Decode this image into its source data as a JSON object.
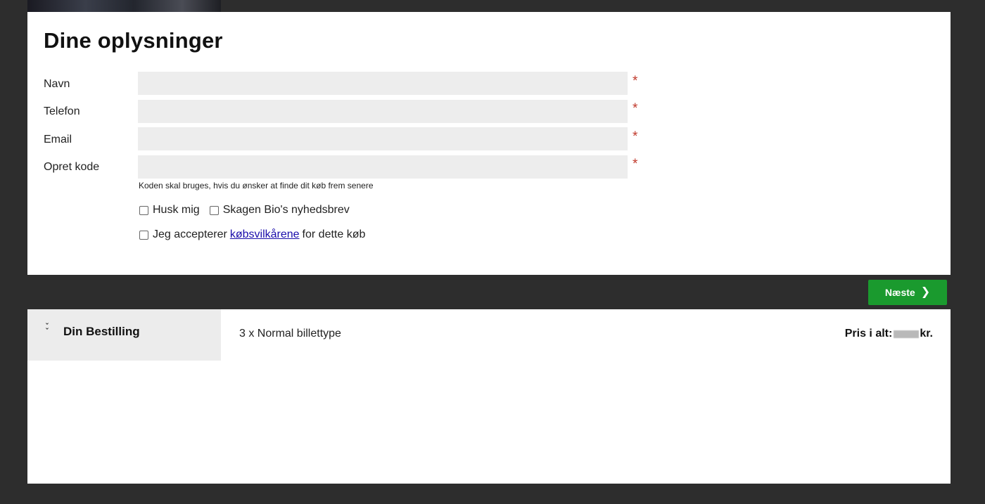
{
  "form": {
    "title": "Dine oplysninger",
    "fields": [
      {
        "label": "Navn",
        "value": "",
        "required": "*"
      },
      {
        "label": "Telefon",
        "value": "",
        "required": "*"
      },
      {
        "label": "Email",
        "value": "",
        "required": "*"
      },
      {
        "label": "Opret kode",
        "value": "",
        "required": "*"
      }
    ],
    "code_hint": "Koden skal bruges, hvis du ønsker at finde dit køb frem senere",
    "remember_label": "Husk mig",
    "newsletter_label": "Skagen Bio's nyhedsbrev",
    "terms_prefix": "Jeg accepterer",
    "terms_link": "købsvilkårene",
    "terms_suffix": "for dette køb"
  },
  "navigation": {
    "next_label": "Næste",
    "next_icon": "chevron-right-icon",
    "accent_color": "#1a9a2e"
  },
  "order": {
    "tab_title": "Din Bestilling",
    "tab_icon": "double-chevron-down-icon",
    "line": "3 x Normal billettype",
    "total_label": "Pris i alt:",
    "total_currency": "kr."
  }
}
